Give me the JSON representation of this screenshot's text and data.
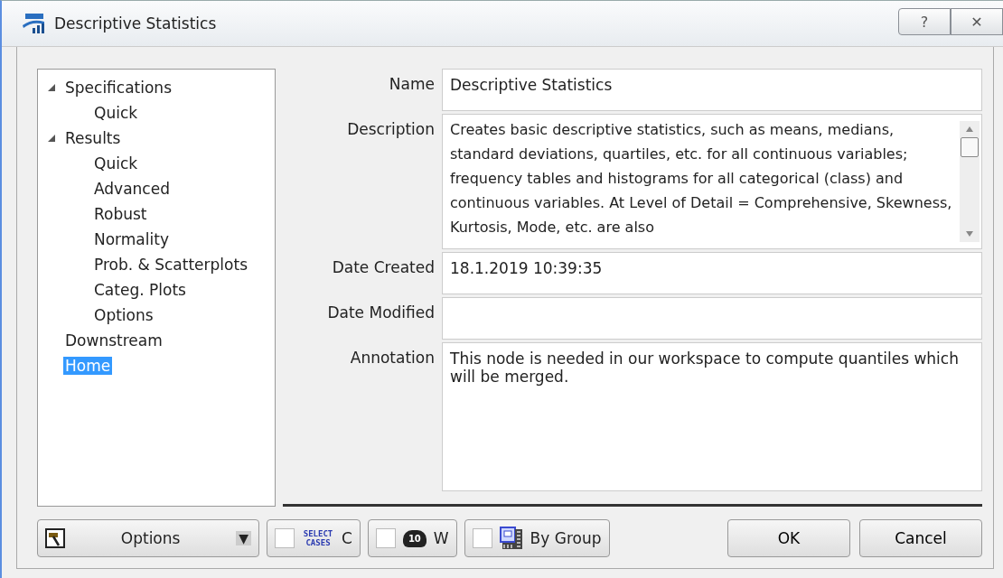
{
  "window": {
    "title": "Descriptive Statistics",
    "buttons": [
      "?",
      "✕"
    ]
  },
  "tree": [
    {
      "label": "Specifications",
      "expanded": true,
      "selected": false,
      "children": [
        {
          "label": "Quick",
          "selected": false
        }
      ]
    },
    {
      "label": "Results",
      "expanded": true,
      "selected": false,
      "children": [
        {
          "label": "Quick",
          "selected": false
        },
        {
          "label": "Advanced",
          "selected": false
        },
        {
          "label": "Robust",
          "selected": false
        },
        {
          "label": "Normality",
          "selected": false
        },
        {
          "label": "Prob. & Scatterplots",
          "selected": false
        },
        {
          "label": "Categ. Plots",
          "selected": false
        },
        {
          "label": "Options",
          "selected": false
        }
      ]
    },
    {
      "label": "Downstream",
      "selected": false
    },
    {
      "label": "Home",
      "selected": true
    }
  ],
  "fields": [
    {
      "label": "Name",
      "kind": "single",
      "value": "Descriptive Statistics"
    },
    {
      "label": "Description",
      "kind": "scroll",
      "value": "Creates basic descriptive statistics, such as means, medians, standard deviations, quartiles, etc. for all continuous variables; frequency tables and histograms for all categorical (class) and continuous variables. At Level of Detail = Comprehensive, Skewness, Kurtosis, Mode, etc. are also"
    },
    {
      "label": "Date Created",
      "kind": "single",
      "value": "18.1.2019 10:39:35"
    },
    {
      "label": "Date Modified",
      "kind": "single"
    },
    {
      "label": "Annotation",
      "kind": "multi",
      "value": "This node is needed in our workspace to compute quantiles which will be merged."
    }
  ],
  "toolbar": [
    {
      "kind": "dropdown",
      "label": "Options",
      "caret": "▼"
    },
    {
      "kind": "select",
      "checked": false,
      "icon_text": "SELECT CASES",
      "label": "C"
    },
    {
      "kind": "weight",
      "checked": false,
      "icon_text": "10",
      "label": "W"
    },
    {
      "kind": "group",
      "checked": false,
      "label": "By Group"
    }
  ],
  "buttons": [
    "OK",
    "Cancel"
  ]
}
